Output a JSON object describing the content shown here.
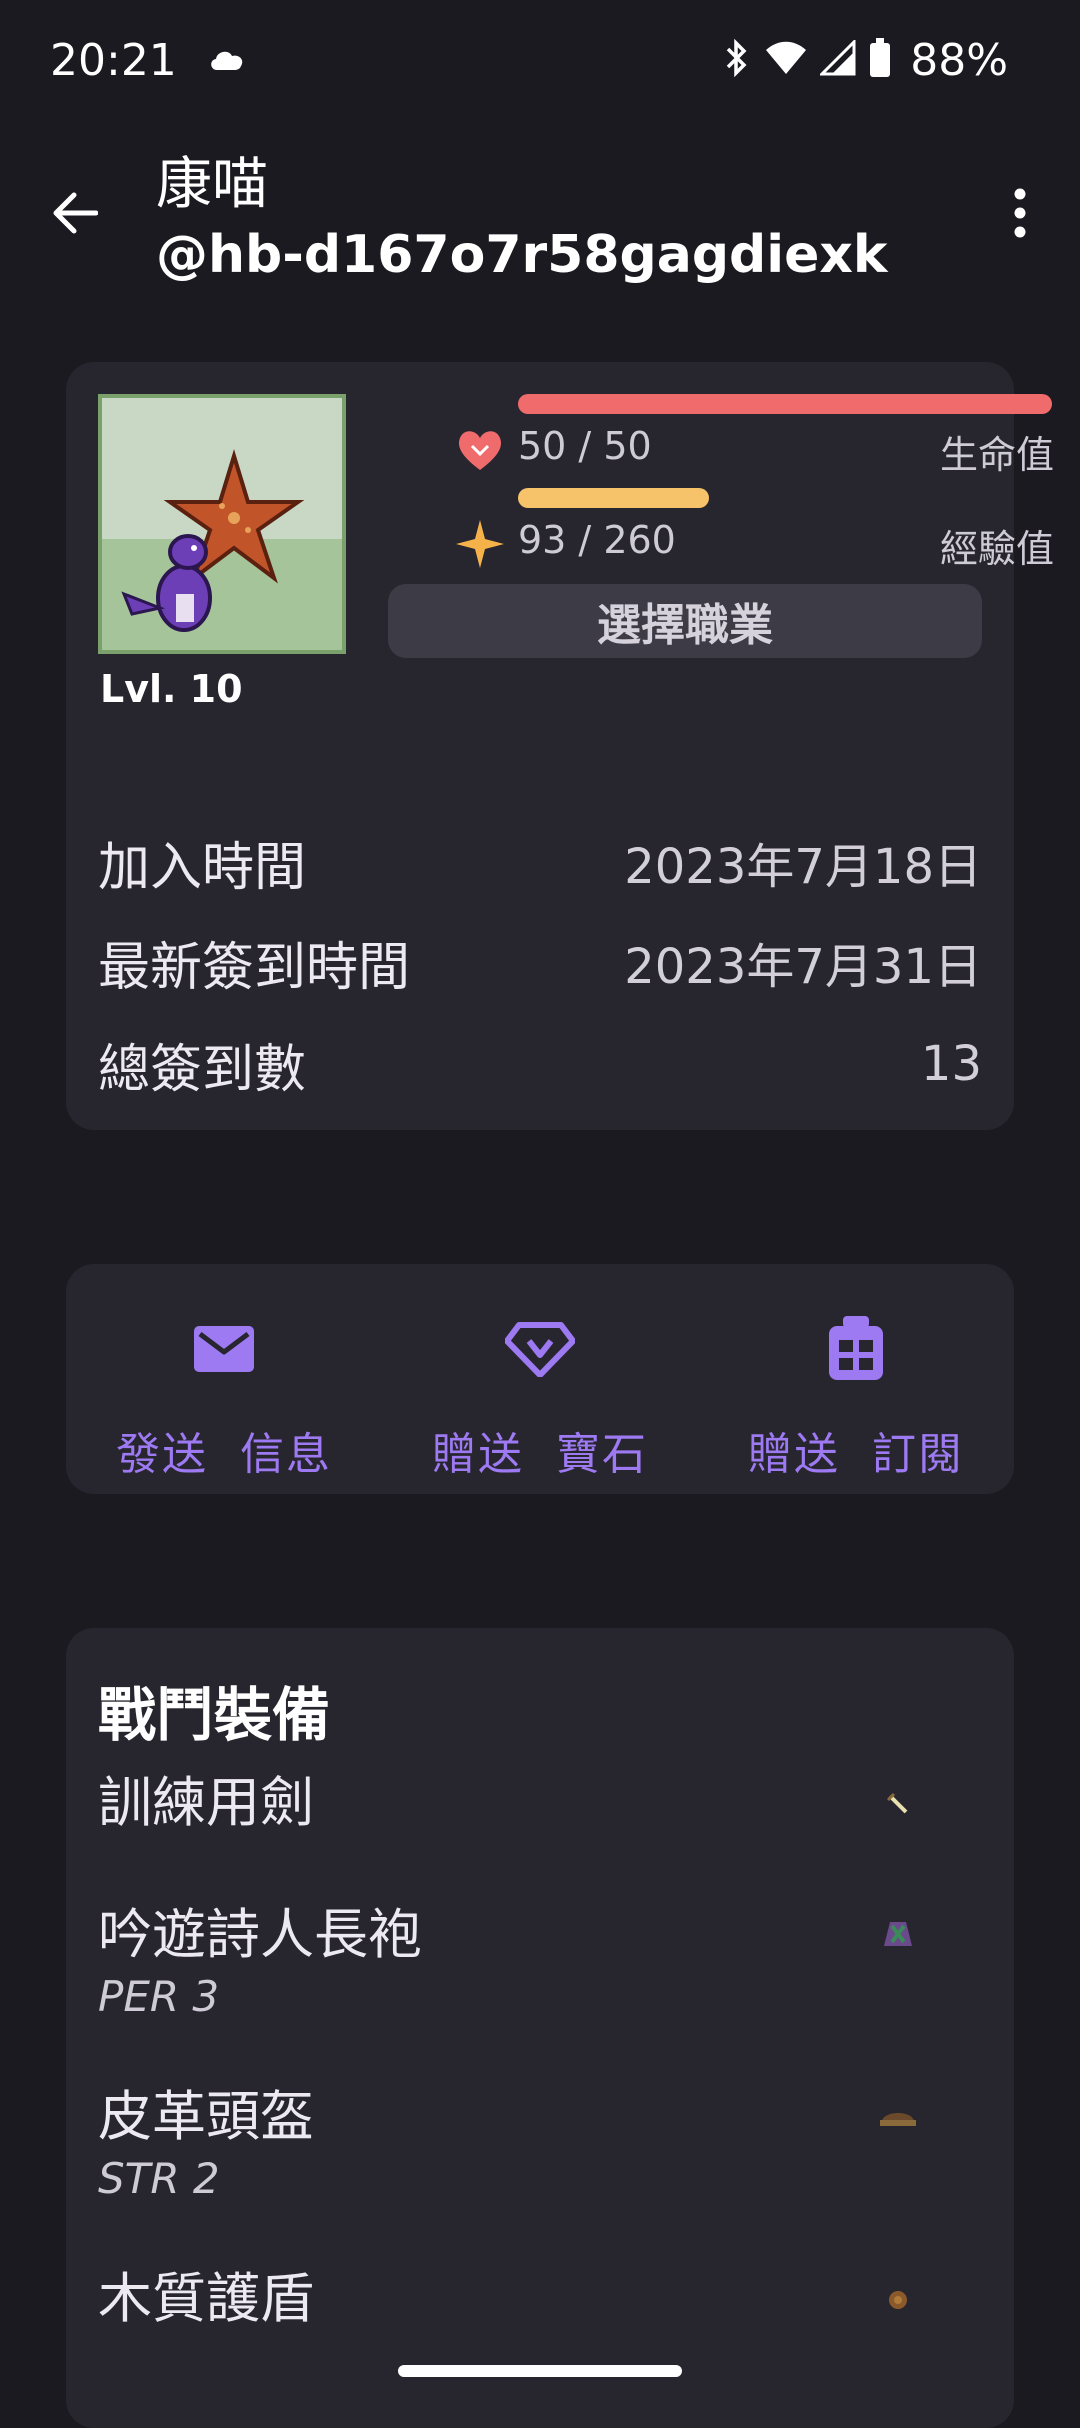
{
  "status_bar": {
    "time": "20:21",
    "battery_percent": "88%",
    "icons": [
      "cloud-icon",
      "bluetooth-icon",
      "wifi-icon",
      "signal-icon",
      "battery-icon"
    ]
  },
  "app_bar": {
    "name": "康喵",
    "handle": "@hb-d167o7r58gagdiexk",
    "back_icon": "arrow-left-icon",
    "more_icon": "more-vert-icon"
  },
  "profile": {
    "level": "Lvl. 10",
    "health": {
      "value": "50 / 50",
      "label": "生命值",
      "current": 50,
      "max": 50,
      "color": "#f06b6b"
    },
    "experience": {
      "value": "93 / 260",
      "label": "經驗值",
      "current": 93,
      "max": 260,
      "color": "#f6c26a"
    },
    "class_button": "選擇職業",
    "info": [
      {
        "label": "加入時間",
        "value": "2023年7月18日"
      },
      {
        "label": "最新簽到時間",
        "value": "2023年7月31日"
      },
      {
        "label": "總簽到數",
        "value": "13"
      }
    ]
  },
  "actions": [
    {
      "label": "發送  信息",
      "icon": "mail-icon"
    },
    {
      "label": "贈送  寶石",
      "icon": "gem-icon"
    },
    {
      "label": "贈送  訂閱",
      "icon": "gift-icon"
    }
  ],
  "gear": {
    "title": "戰鬥裝備",
    "items": [
      {
        "name": "訓練用劍",
        "stat": "",
        "icon": "sword-icon"
      },
      {
        "name": "吟遊詩人長袍",
        "stat": "PER 3",
        "icon": "robe-icon"
      },
      {
        "name": "皮革頭盔",
        "stat": "STR 2",
        "icon": "helmet-icon"
      },
      {
        "name": "木質護盾",
        "stat": "",
        "icon": "shield-icon"
      }
    ]
  },
  "colors": {
    "accent": "#9d79f2",
    "card": "#27262f",
    "background": "#1b1a21"
  }
}
